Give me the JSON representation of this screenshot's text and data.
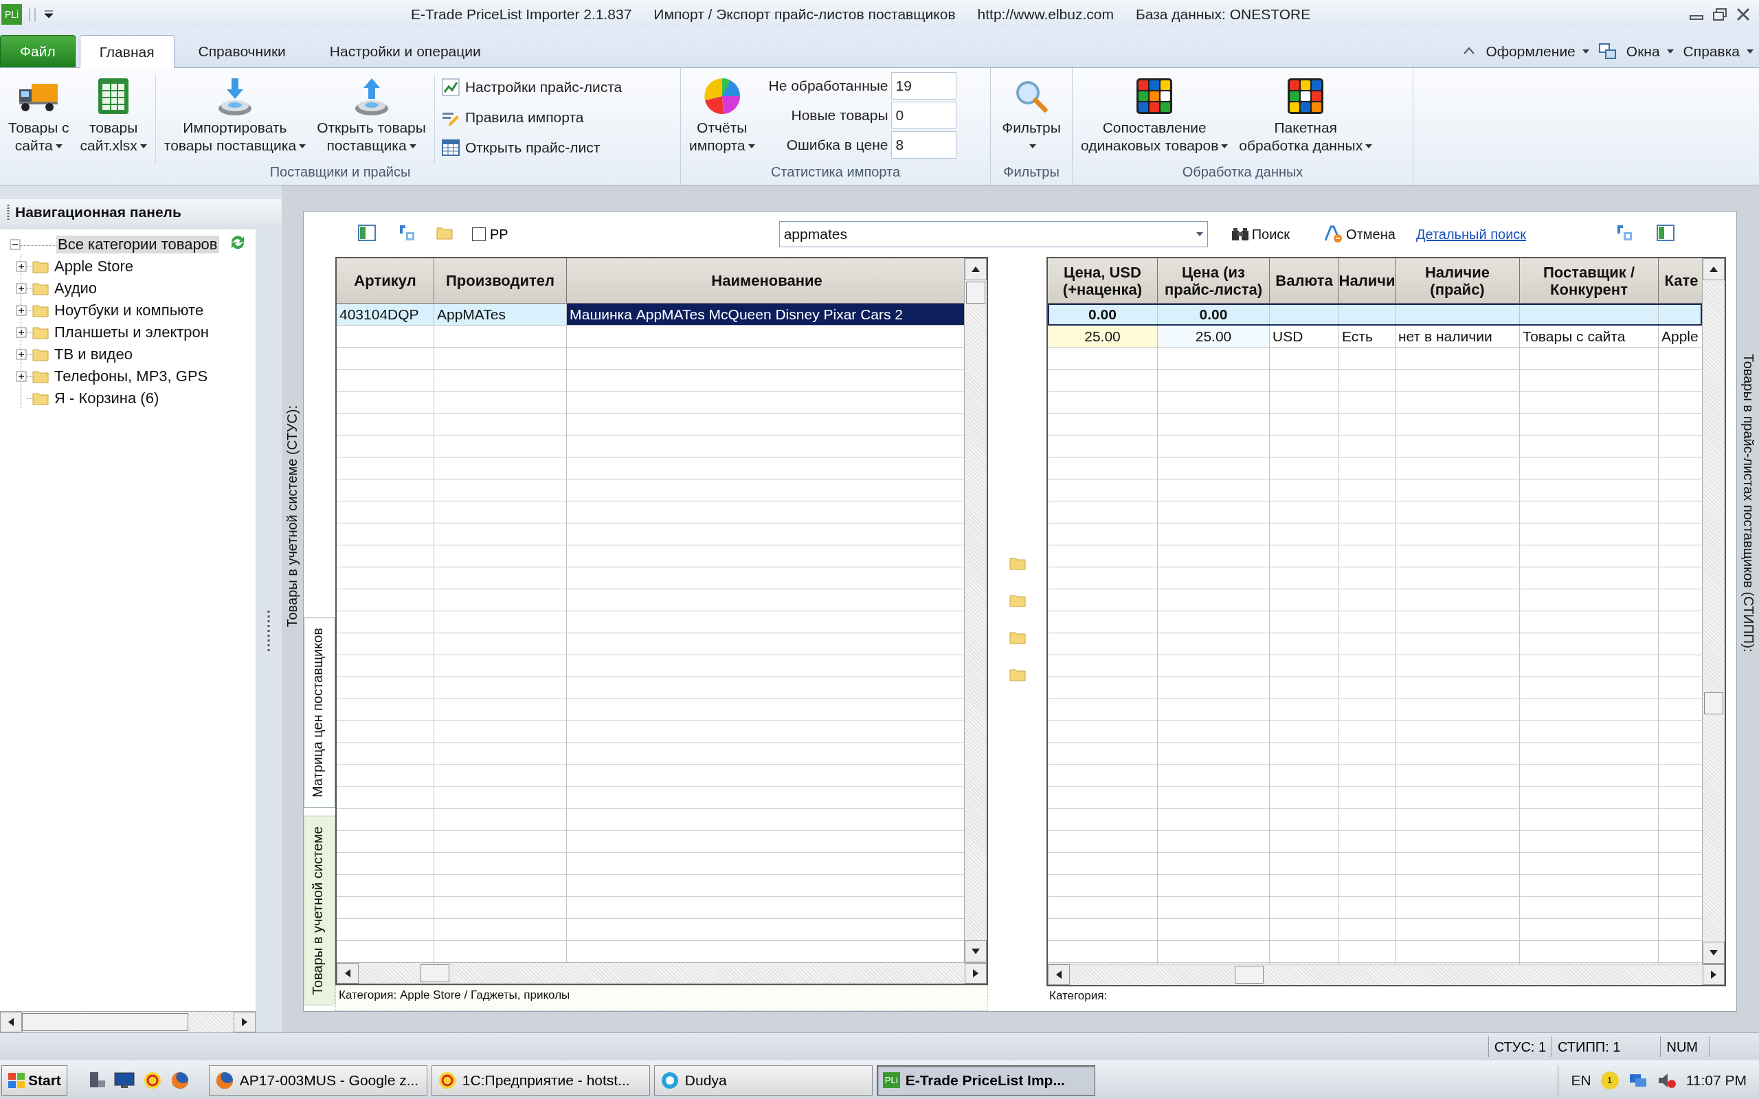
{
  "window": {
    "logo": "PLi",
    "title_parts": [
      "E-Trade PriceList Importer 2.1.837",
      "Импорт / Экспорт прайс-листов поставщиков",
      "http://www.elbuz.com",
      "База данных: ONESTORE"
    ]
  },
  "ribbon": {
    "tabs": [
      {
        "label": "Файл",
        "kind": "file",
        "selected": false
      },
      {
        "label": "Главная",
        "kind": "tab",
        "selected": true
      },
      {
        "label": "Справочники",
        "kind": "tab",
        "selected": false
      },
      {
        "label": "Настройки и операции",
        "kind": "tab",
        "selected": false
      }
    ],
    "menus": [
      "Оформление",
      "Окна",
      "Справка"
    ],
    "groups": [
      {
        "title": "Поставщики и прайсы",
        "items": [
          {
            "kind": "large",
            "lines": [
              "Товары с",
              "сайта"
            ],
            "dropdown": true
          },
          {
            "kind": "large",
            "lines": [
              "товары",
              "сайт.xlsx"
            ],
            "dropdown": true
          },
          {
            "kind": "separator"
          },
          {
            "kind": "large",
            "lines": [
              "Импортировать",
              "товары поставщика"
            ],
            "dropdown": true
          },
          {
            "kind": "large",
            "lines": [
              "Открыть товары",
              "поставщика"
            ],
            "dropdown": true
          },
          {
            "kind": "separator"
          },
          {
            "kind": "small_stack",
            "buttons": [
              "Настройки прайс-листа",
              "Правила импорта",
              "Открыть прайс-лист"
            ]
          }
        ]
      },
      {
        "title": "Статистика импорта",
        "items": [
          {
            "kind": "large",
            "lines": [
              "Отчёты",
              "импорта"
            ],
            "dropdown": true
          },
          {
            "kind": "stats",
            "rows": [
              {
                "label": "Не обработанные",
                "value": "19"
              },
              {
                "label": "Новые товары",
                "value": "0"
              },
              {
                "label": "Ошибка в цене",
                "value": "8"
              }
            ]
          }
        ]
      },
      {
        "title": "Фильтры",
        "items": [
          {
            "kind": "large",
            "lines": [
              "Фильтры"
            ],
            "dropdown": true
          }
        ]
      },
      {
        "title": "Обработка данных",
        "items": [
          {
            "kind": "large",
            "lines": [
              "Сопоставление",
              "одинаковых товаров"
            ],
            "dropdown": true
          },
          {
            "kind": "large",
            "lines": [
              "Пакетная",
              "обработка данных"
            ],
            "dropdown": true
          }
        ]
      }
    ]
  },
  "navigation": {
    "title": "Навигационная панель",
    "tree": [
      {
        "label": "Все категории товаров",
        "expanded": true,
        "selected": true,
        "children": [
          {
            "label": "Apple Store",
            "expandable": true,
            "selected": false
          },
          {
            "label": "Аудио",
            "expandable": true,
            "selected": false
          },
          {
            "label": "Ноутбуки и компьюте",
            "expandable": true,
            "selected": false
          },
          {
            "label": "Планшеты и электрон",
            "expandable": true,
            "selected": false
          },
          {
            "label": "ТВ и видео",
            "expandable": true,
            "selected": false
          },
          {
            "label": "Телефоны, MP3, GPS",
            "expandable": true,
            "selected": false
          },
          {
            "label": "Я - Корзина (6)",
            "expandable": false,
            "selected": false
          }
        ]
      }
    ]
  },
  "workspace": {
    "side_label": "Товары в учетной системе (СТУС):",
    "right_label": "Товары в прайс-листах поставщиков (СТИПП):",
    "view_tabs": [
      {
        "label": "Матрица цен поставщиков",
        "selected": true
      },
      {
        "label": "Товары в учетной системе",
        "selected": false
      }
    ],
    "toolbar": {
      "checkbox": {
        "label": "PP",
        "checked": false
      },
      "search": {
        "value": "appmates"
      },
      "search_button": "Поиск",
      "cancel_button": "Отмена",
      "advanced_link": "Детальный поиск"
    },
    "left_grid": {
      "columns": [
        "Артикул",
        "Производител",
        "Наименование"
      ],
      "rows": [
        {
          "selected": true,
          "cells": [
            {
              "text": "403104DQP",
              "focused": false
            },
            {
              "text": "AppMATes",
              "focused": false
            },
            {
              "text": "Машинка AppMATes McQueen Disney Pixar Cars 2",
              "focused": true
            }
          ]
        }
      ],
      "footer": "Категория: Apple Store / Гаджеты, приколы"
    },
    "right_grid": {
      "columns": [
        "Цена, USD\n(+наценка)",
        "Цена (из\nпрайс-листа)",
        "Валюта",
        "Наличи",
        "Наличие\n(прайс)",
        "Поставщик /\nКонкурент",
        "Кате"
      ],
      "rows": [
        {
          "kind": "total",
          "selected": true,
          "cells": [
            "0.00",
            "0.00"
          ]
        },
        {
          "kind": "data",
          "selected": false,
          "cells": [
            "25.00",
            "25.00",
            "USD",
            "Есть",
            "нет в наличии",
            "Товары с сайта",
            "Apple"
          ]
        }
      ],
      "footer": "Категория:"
    }
  },
  "status_bar": {
    "cells": [
      "СТУС: 1",
      "СТИПП: 1",
      "NUM"
    ]
  },
  "taskbar": {
    "start": "Start",
    "tasks": [
      {
        "label": "AP17-003MUS - Google z...",
        "active": false
      },
      {
        "label": "1С:Предприятие - hotst...",
        "active": false
      },
      {
        "label": "Dudya",
        "active": false
      },
      {
        "label": "E-Trade PriceList Imp...",
        "active": true,
        "badge": "PLi"
      }
    ],
    "language": "EN",
    "tray_badge": "1",
    "clock": "11:07 PM"
  }
}
